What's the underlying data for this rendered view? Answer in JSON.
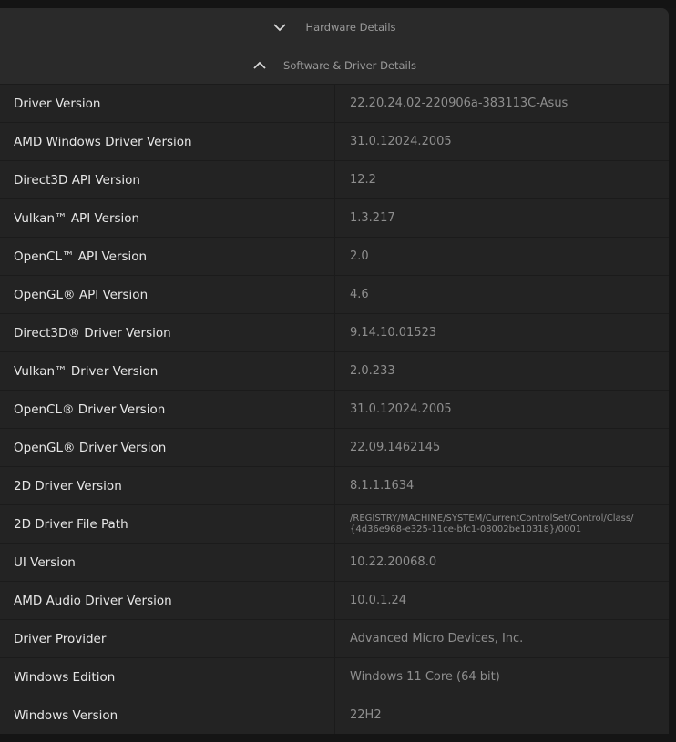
{
  "hardware_header": {
    "label": "Hardware Details",
    "chevron_icon": "chevron-down-icon"
  },
  "software_header": {
    "label": "Software & Driver Details",
    "chevron_icon": "chevron-up-icon"
  },
  "rows": [
    {
      "label": "Driver Version",
      "value": "22.20.24.02-220906a-383113C-Asus"
    },
    {
      "label": "AMD Windows Driver Version",
      "value": "31.0.12024.2005"
    },
    {
      "label": "Direct3D API Version",
      "value": "12.2"
    },
    {
      "label": "Vulkan™ API Version",
      "value": "1.3.217"
    },
    {
      "label": "OpenCL™ API Version",
      "value": "2.0"
    },
    {
      "label": "OpenGL® API Version",
      "value": "4.6"
    },
    {
      "label": "Direct3D® Driver Version",
      "value": "9.14.10.01523"
    },
    {
      "label": "Vulkan™ Driver Version",
      "value": "2.0.233"
    },
    {
      "label": "OpenCL® Driver Version",
      "value": "31.0.12024.2005"
    },
    {
      "label": "OpenGL® Driver Version",
      "value": "22.09.1462145"
    },
    {
      "label": "2D Driver Version",
      "value": "8.1.1.1634"
    },
    {
      "label": "2D Driver File Path",
      "value": "/REGISTRY/MACHINE/SYSTEM/CurrentControlSet/Control/Class/\n{4d36e968-e325-11ce-bfc1-08002be10318}/0001"
    },
    {
      "label": "UI Version",
      "value": "10.22.20068.0"
    },
    {
      "label": "AMD Audio Driver Version",
      "value": "10.0.1.24"
    },
    {
      "label": "Driver Provider",
      "value": "Advanced Micro Devices, Inc."
    },
    {
      "label": "Windows Edition",
      "value": "Windows 11 Core (64 bit)"
    },
    {
      "label": "Windows Version",
      "value": "22H2"
    }
  ],
  "colors": {
    "background": "#151515",
    "panel": "#232323",
    "header": "#2a2a2a",
    "label_text": "#e6e6e6",
    "value_text": "#8e8e8e"
  }
}
